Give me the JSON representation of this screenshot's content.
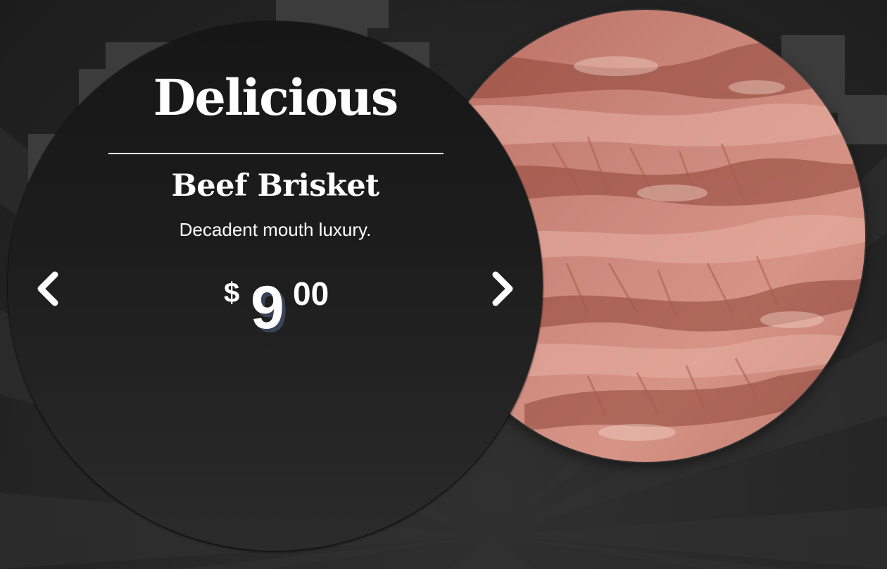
{
  "menu": {
    "heading": "Delicious",
    "item_name": "Beef Brisket",
    "item_description": "Decadent mouth luxury.",
    "price": {
      "currency_symbol": "$",
      "dollars": "9",
      "cents": "00"
    }
  },
  "nav": {
    "prev_icon": "chevron-left-icon",
    "next_icon": "chevron-right-icon"
  },
  "colors": {
    "background": "#2a2a2a",
    "panel": "#1d1d1d",
    "text": "#ffffff",
    "price_shadow": "#3a4458",
    "meat": "#c98478"
  }
}
